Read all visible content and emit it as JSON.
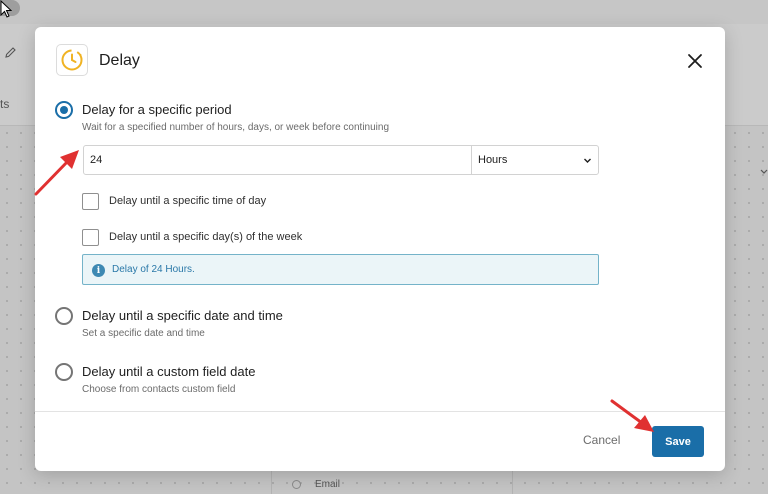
{
  "background": {
    "sidebar_fragment": "ts",
    "node_label": "Email"
  },
  "modal": {
    "title": "Delay",
    "icon": "clock-delay-icon",
    "close_icon": "close-icon"
  },
  "options": [
    {
      "label": "Delay for a specific period",
      "description": "Wait for a specified number of hours, days, or week before continuing",
      "selected": true
    },
    {
      "label": "Delay until a specific date and time",
      "description": "Set a specific date and time",
      "selected": false
    },
    {
      "label": "Delay until a custom field date",
      "description": "Choose from contacts custom field",
      "selected": false
    }
  ],
  "period": {
    "value": "24",
    "unit": "Hours"
  },
  "checkboxes": [
    {
      "label": "Delay until a specific time of day",
      "checked": false
    },
    {
      "label": "Delay until a specific day(s) of the week",
      "checked": false
    }
  ],
  "info": {
    "text": "Delay of 24 Hours."
  },
  "footer": {
    "cancel_label": "Cancel",
    "save_label": "Save"
  },
  "colors": {
    "primary": "#1a6ea8",
    "accent_icon": "#f0b323",
    "info_text": "#2a78a8",
    "annotation_arrow": "#e03131"
  }
}
